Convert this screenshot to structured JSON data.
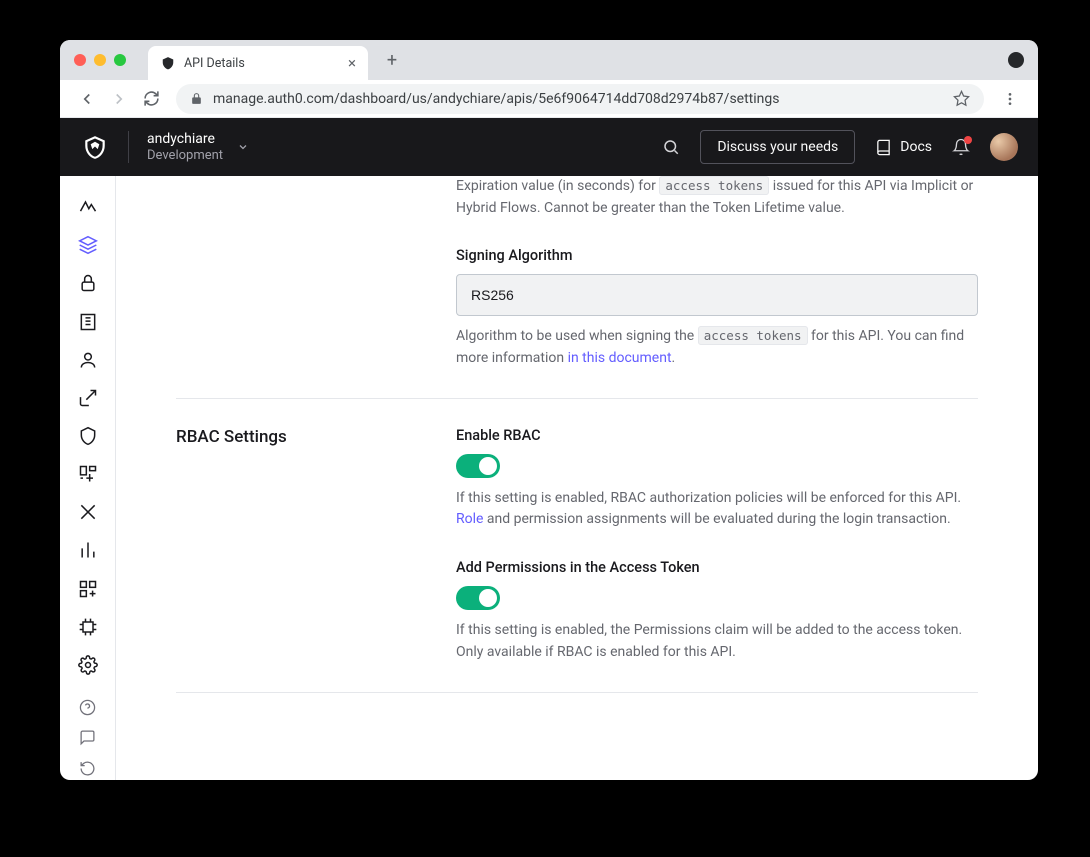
{
  "browser": {
    "tab_title": "API Details",
    "url": "manage.auth0.com/dashboard/us/andychiare/apis/5e6f9064714dd708d2974b87/settings"
  },
  "header": {
    "tenant_name": "andychiare",
    "tenant_env": "Development",
    "discuss_button": "Discuss your needs",
    "docs_label": "Docs"
  },
  "sections": {
    "token": {
      "expiration_help_pre": "Expiration value (in seconds) for ",
      "expiration_code": "access tokens",
      "expiration_help_post": " issued for this API via Implicit or Hybrid Flows. Cannot be greater than the Token Lifetime value.",
      "signing_label": "Signing Algorithm",
      "signing_value": "RS256",
      "signing_help_pre": "Algorithm to be used when signing the ",
      "signing_code": "access tokens",
      "signing_help_mid": " for this API. You can find more information ",
      "signing_link": "in this document",
      "signing_help_post": "."
    },
    "rbac": {
      "title": "RBAC Settings",
      "enable_label": "Enable RBAC",
      "enable_on": true,
      "enable_help_pre": "If this setting is enabled, RBAC authorization policies will be enforced for this API. ",
      "enable_help_link": "Role",
      "enable_help_post": " and permission assignments will be evaluated during the login transaction.",
      "perms_label": "Add Permissions in the Access Token",
      "perms_on": true,
      "perms_help": "If this setting is enabled, the Permissions claim will be added to the access token. Only available if RBAC is enabled for this API."
    }
  }
}
